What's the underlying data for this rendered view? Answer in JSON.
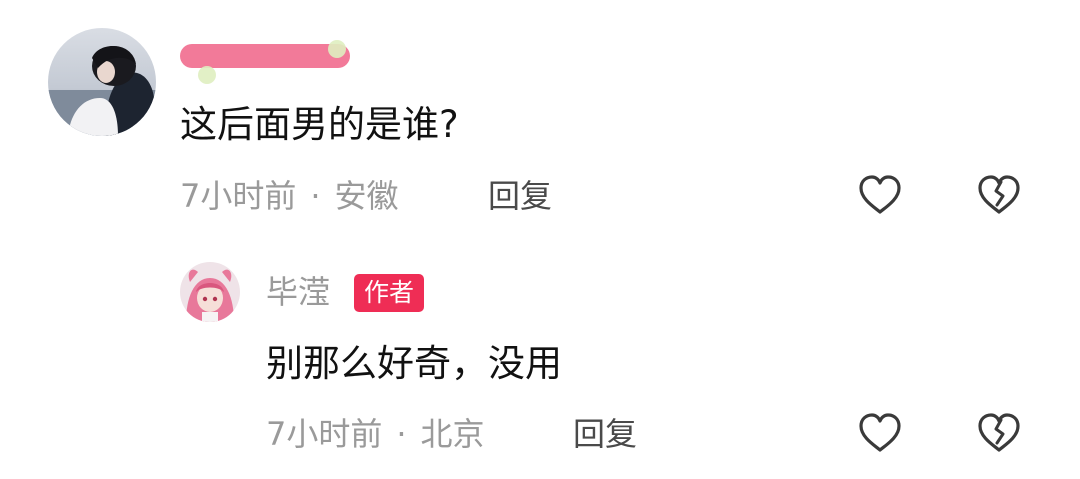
{
  "comment": {
    "text": "这后面男的是谁?",
    "time": "7小时前",
    "separator": "·",
    "location": "安徽",
    "reply_label": "回复",
    "like_icon": "heart-outline-icon",
    "dislike_icon": "broken-heart-icon"
  },
  "reply": {
    "username": "毕滢",
    "badge": "作者",
    "text": "别那么好奇，没用",
    "time": "7小时前",
    "separator": "·",
    "location": "北京",
    "reply_label": "回复",
    "like_icon": "heart-outline-icon",
    "dislike_icon": "broken-heart-icon"
  },
  "colors": {
    "badge": "#ef2d55",
    "meta_text": "#9a9a9a",
    "body_text": "#111111",
    "icon_stroke": "#3a3a3a",
    "redaction": "#f27a99"
  }
}
